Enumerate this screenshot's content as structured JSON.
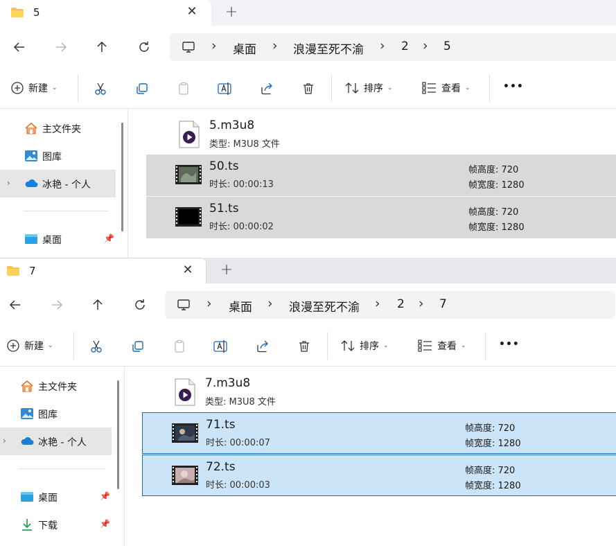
{
  "windows": [
    {
      "tab_title": "5",
      "breadcrumb": [
        "桌面",
        "浪漫至死不渝",
        "2",
        "5"
      ],
      "toolbar": {
        "new_label": "新建",
        "sort_label": "排序",
        "view_label": "查看",
        "more_label": "•••"
      },
      "sidebar": {
        "items": [
          "主文件夹",
          "图库",
          "冰艳 - 个人",
          "桌面"
        ]
      },
      "playlist": {
        "name": "5.m3u8",
        "type": "类型: M3U8 文件"
      },
      "files": [
        {
          "name": "50.ts",
          "duration": "时长: 00:00:13",
          "height": "帧高度: 720",
          "width": "帧宽度: 1280"
        },
        {
          "name": "51.ts",
          "duration": "时长: 00:00:02",
          "height": "帧高度: 720",
          "width": "帧宽度: 1280"
        }
      ]
    },
    {
      "tab_title": "7",
      "breadcrumb": [
        "桌面",
        "浪漫至死不渝",
        "2",
        "7"
      ],
      "toolbar": {
        "new_label": "新建",
        "sort_label": "排序",
        "view_label": "查看",
        "more_label": "•••"
      },
      "sidebar": {
        "items": [
          "主文件夹",
          "图库",
          "冰艳 - 个人",
          "桌面",
          "下载"
        ]
      },
      "playlist": {
        "name": "7.m3u8",
        "type": "类型: M3U8 文件"
      },
      "files": [
        {
          "name": "71.ts",
          "duration": "时长: 00:00:07",
          "height": "帧高度: 720",
          "width": "帧宽度: 1280"
        },
        {
          "name": "72.ts",
          "duration": "时长: 00:00:03",
          "height": "帧高度: 720",
          "width": "帧宽度: 1280"
        }
      ]
    }
  ],
  "icons": {
    "tab_close": "✕",
    "tab_add": "+",
    "breadcrumb_sep": "›",
    "expand": "›",
    "pin": "📌"
  },
  "colors": {
    "accent": "#1c6ab3",
    "selection_blue": "#cce4f7",
    "selection_grey": "#d9d9d9",
    "folder": "#f4c24d",
    "onedrive": "#1a7fd6"
  }
}
